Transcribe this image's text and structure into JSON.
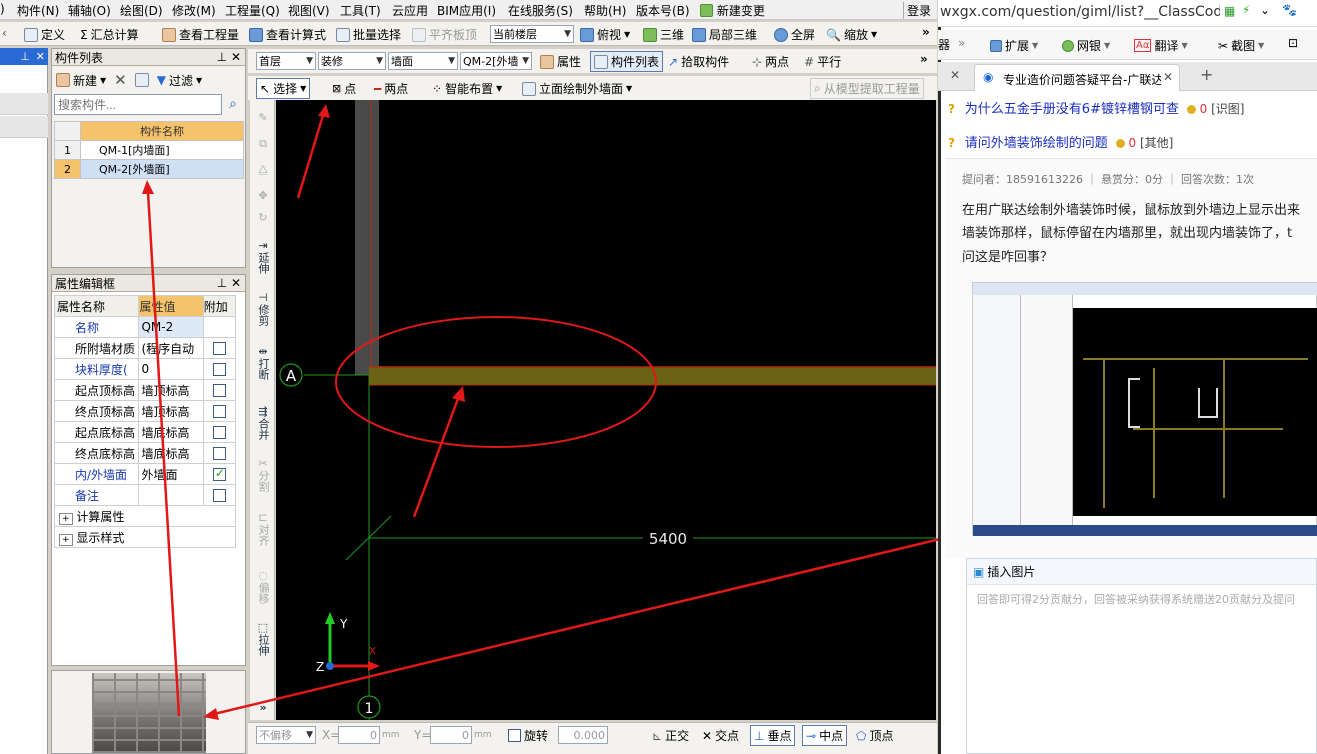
{
  "menu": [
    "构件(N)",
    "辅轴(O)",
    "绘图(D)",
    "修改(M)",
    "工程量(Q)",
    "视图(V)",
    "工具(T)",
    "云应用",
    "BIM应用(I)",
    "在线服务(S)",
    "帮助(H)",
    "版本号(B)",
    "新建变更",
    "登录"
  ],
  "menu_first": ")",
  "toolbar1": {
    "define": "定义",
    "sum": "汇总计算",
    "view_qty": "查看工程量",
    "view_formula": "查看计算式",
    "batch_select": "批量选择",
    "align_top": "平齐板顶",
    "floor_select": "当前楼层",
    "view": "俯视",
    "three_d": "三维",
    "local_3d": "局部三维",
    "full": "全屏",
    "zoom": "缩放"
  },
  "selectors": {
    "floor": "首层",
    "category": "装修",
    "type": "墙面",
    "component": "QM-2[外墙"
  },
  "toolbar2": {
    "props": "属性",
    "comp_list": "构件列表",
    "pick": "拾取构件",
    "two_point": "两点",
    "parallel": "平行"
  },
  "toolbar3": {
    "select": "选择",
    "point": "点",
    "two_point": "两点",
    "smart": "智能布置",
    "elev_draw": "立面绘制外墙面",
    "extract": "从模型提取工程量"
  },
  "complist": {
    "title": "构件列表",
    "new": "新建",
    "filter": "过滤",
    "search_placeholder": "搜索构件...",
    "header": "构件名称",
    "rows": [
      {
        "num": "1",
        "name": "QM-1[内墙面]"
      },
      {
        "num": "2",
        "name": "QM-2[外墙面]"
      }
    ]
  },
  "props": {
    "title": "属性编辑框",
    "headers": [
      "属性名称",
      "属性值",
      "附加"
    ],
    "rows": [
      {
        "name": "名称",
        "value": "QM-2",
        "style": "blue",
        "check": null
      },
      {
        "name": "所附墙材质",
        "value": "(程序自动",
        "style": "blk",
        "check": false
      },
      {
        "name": "块料厚度(",
        "value": "0",
        "style": "blue",
        "check": false
      },
      {
        "name": "起点顶标高",
        "value": "墙顶标高",
        "style": "blk",
        "check": false
      },
      {
        "name": "终点顶标高",
        "value": "墙顶标高",
        "style": "blk",
        "check": false
      },
      {
        "name": "起点底标高",
        "value": "墙底标高",
        "style": "blk",
        "check": false
      },
      {
        "name": "终点底标高",
        "value": "墙底标高",
        "style": "blk",
        "check": false
      },
      {
        "name": "内/外墙面",
        "value": "外墙面",
        "style": "blue",
        "check": true
      },
      {
        "name": "备注",
        "value": "",
        "style": "blue",
        "check": false
      }
    ],
    "groups": [
      "计算属性",
      "显示样式"
    ]
  },
  "vtools": [
    "延伸",
    "修剪",
    "打断",
    "合并",
    "分割",
    "对齐",
    "偏移",
    "拉伸"
  ],
  "canvas": {
    "axis_a": "A",
    "axis_1": "1",
    "dimension": "5400",
    "y_label": "Y",
    "z_label": "Z",
    "x_label": "X"
  },
  "status": {
    "no_offset": "不偏移",
    "x_label": "X=",
    "x_val": "0",
    "y_label": "Y=",
    "y_val": "0",
    "unit": "mm",
    "rotate": "旋转",
    "angle": "0.000",
    "ortho": "正交",
    "intersect": "交点",
    "perp": "垂点",
    "mid": "中点",
    "vertex": "顶点"
  },
  "browser": {
    "url": "wxgx.com/question/giml/list?__ClassCode",
    "bookmarks": [
      "扩展",
      "网银",
      "翻译",
      "截图"
    ],
    "tab_title": "专业造价问题答疑平台-广联达",
    "q1": "为什么五金手册没有6#镀锌槽钢可查",
    "q1_score": "0",
    "q1_tag": "[识图]",
    "q2": "请问外墙装饰绘制的问题",
    "q2_score": "0",
    "q2_tag": "[其他]",
    "meta": "提问者：18591613226 ｜ 悬赏分：0分 ｜ 回答次数：1次",
    "body_line1": "在用广联达绘制外墙装饰时候，鼠标放到外墙边上显示出来",
    "body_line2": "墙装饰那样，鼠标停留在内墙那里，就出现内墙装饰了，t",
    "body_line3": "问这是咋回事？",
    "insert_image": "插入图片",
    "answer_placeholder": "回答即可得2分贡献分，回答被采纳获得系统赠送20贡献分及提问"
  },
  "colors": {
    "canvas": "#000000",
    "wall_fill": "#6b6214",
    "wall_line": "#b03010",
    "annot": "#e01818",
    "grid": "#1e9a1e",
    "accent": "#f5c36b"
  }
}
